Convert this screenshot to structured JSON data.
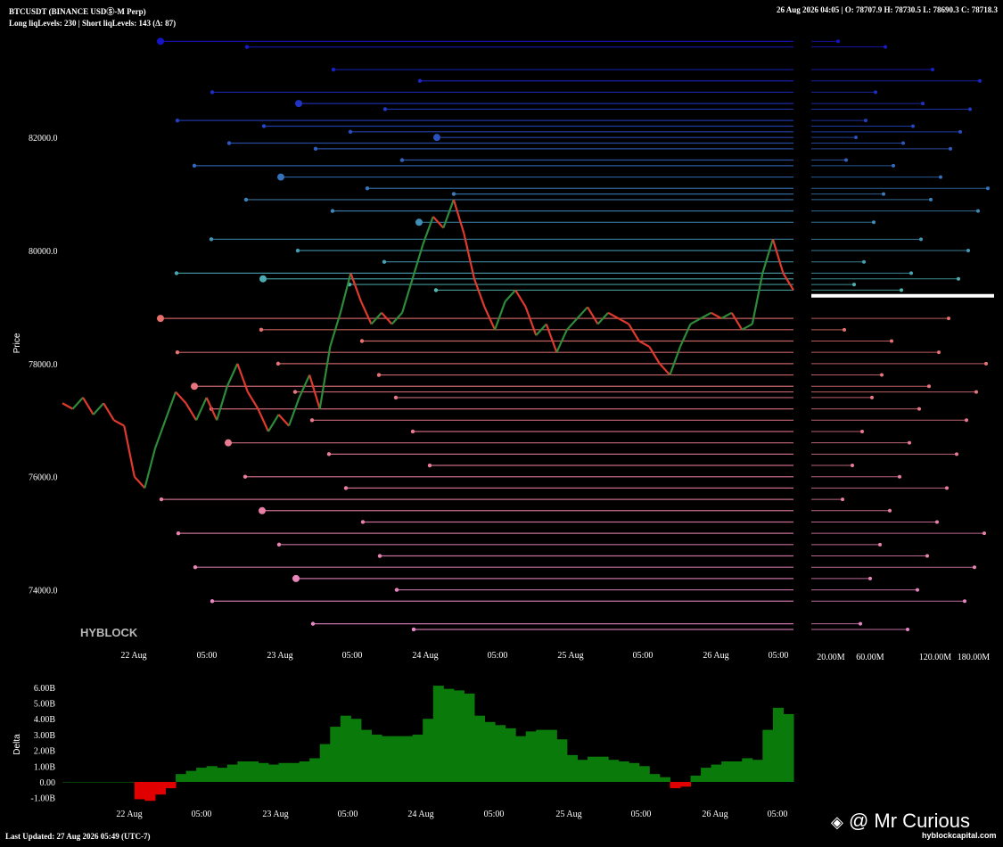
{
  "header": {
    "symbol": "BTCUSDT (BINANCE USDⓈ-M Perp)",
    "levels": "Long liqLevels: 230 | Short liqLevels: 143 (Δ: 87)",
    "ohlc": "26 Aug 2026 04:05 | O: 78707.9 H: 78730.5 L: 78690.3 C: 78718.3"
  },
  "footer": {
    "last_updated": "Last Updated: 27 Aug 2026 05:49 (UTC-7)",
    "credit": "@ Mr Curious",
    "site": "hyblockcapital.com"
  },
  "colors": {
    "candle_up": "#2e8b3a",
    "candle_down": "#e03a2e",
    "short_liq_far": "#1515c8",
    "short_liq_near": "#4fb8b0",
    "long_liq_near": "#e8706a",
    "long_liq_far": "#e888c8",
    "current_price_line": "#ffffff",
    "delta_positive": "#0a7a0a",
    "delta_negative": "#e00000"
  },
  "chart_data": [
    {
      "type": "line",
      "name": "price",
      "ylabel": "Price",
      "brand": "HYBLOCK",
      "yticks": [
        "82000.0",
        "80000.0",
        "78000.0",
        "76000.0",
        "74000.0"
      ],
      "ylim": [
        73000,
        83800
      ],
      "xticks": [
        "22 Aug",
        "05:00",
        "23 Aug",
        "05:00",
        "24 Aug",
        "05:00",
        "25 Aug",
        "05:00",
        "26 Aug",
        "05:00"
      ],
      "current_price": 79200,
      "price_path": [
        [
          0,
          77300
        ],
        [
          1,
          77200
        ],
        [
          2,
          77400
        ],
        [
          3,
          77100
        ],
        [
          4,
          77300
        ],
        [
          5,
          77000
        ],
        [
          6,
          76900
        ],
        [
          7,
          76000
        ],
        [
          8,
          75800
        ],
        [
          9,
          76500
        ],
        [
          10,
          77000
        ],
        [
          11,
          77500
        ],
        [
          12,
          77300
        ],
        [
          13,
          77000
        ],
        [
          14,
          77400
        ],
        [
          15,
          77000
        ],
        [
          16,
          77600
        ],
        [
          17,
          78000
        ],
        [
          18,
          77500
        ],
        [
          19,
          77200
        ],
        [
          20,
          76800
        ],
        [
          21,
          77100
        ],
        [
          22,
          76900
        ],
        [
          23,
          77400
        ],
        [
          24,
          77800
        ],
        [
          25,
          77200
        ],
        [
          26,
          78300
        ],
        [
          27,
          78900
        ],
        [
          28,
          79600
        ],
        [
          29,
          79100
        ],
        [
          30,
          78700
        ],
        [
          31,
          78900
        ],
        [
          32,
          78700
        ],
        [
          33,
          78900
        ],
        [
          34,
          79500
        ],
        [
          35,
          80100
        ],
        [
          36,
          80600
        ],
        [
          37,
          80400
        ],
        [
          38,
          80900
        ],
        [
          39,
          80300
        ],
        [
          40,
          79500
        ],
        [
          41,
          79000
        ],
        [
          42,
          78600
        ],
        [
          43,
          79100
        ],
        [
          44,
          79300
        ],
        [
          45,
          79000
        ],
        [
          46,
          78500
        ],
        [
          47,
          78700
        ],
        [
          48,
          78200
        ],
        [
          49,
          78600
        ],
        [
          50,
          78800
        ],
        [
          51,
          79000
        ],
        [
          52,
          78700
        ],
        [
          53,
          78900
        ],
        [
          54,
          78800
        ],
        [
          55,
          78700
        ],
        [
          56,
          78400
        ],
        [
          57,
          78300
        ],
        [
          58,
          78000
        ],
        [
          59,
          77800
        ],
        [
          60,
          78300
        ],
        [
          61,
          78700
        ],
        [
          62,
          78800
        ],
        [
          63,
          78900
        ],
        [
          64,
          78800
        ],
        [
          65,
          78900
        ],
        [
          66,
          78600
        ],
        [
          67,
          78700
        ],
        [
          68,
          79600
        ],
        [
          69,
          80200
        ],
        [
          70,
          79600
        ],
        [
          71,
          79300
        ]
      ],
      "short_liq_levels": [
        83700,
        83600,
        83200,
        83000,
        82800,
        82600,
        82500,
        82300,
        82200,
        82100,
        82000,
        81900,
        81800,
        81600,
        81500,
        81300,
        81100,
        81000,
        80900,
        80700,
        80500,
        80200,
        80000,
        79800,
        79600,
        79500,
        79400,
        79300
      ],
      "long_liq_levels": [
        78800,
        78600,
        78400,
        78200,
        78000,
        77800,
        77600,
        77500,
        77400,
        77200,
        77000,
        76800,
        76600,
        76400,
        76200,
        76000,
        75800,
        75600,
        75400,
        75200,
        75000,
        74800,
        74600,
        74400,
        74200,
        74000,
        73800,
        73400,
        73300
      ]
    },
    {
      "type": "bar",
      "name": "liq-profile",
      "xticks": [
        "20.00M",
        "60.00M",
        "120.00M",
        "180.00M"
      ]
    },
    {
      "type": "area",
      "name": "delta",
      "ylabel": "Delta",
      "yticks": [
        "6.00B",
        "5.00B",
        "4.00B",
        "3.00B",
        "2.00B",
        "1.00B",
        "0.00",
        "-1.00B"
      ],
      "ylim": [
        -1.3,
        6.5
      ],
      "xticks": [
        "22 Aug",
        "05:00",
        "23 Aug",
        "05:00",
        "24 Aug",
        "05:00",
        "25 Aug",
        "05:00",
        "26 Aug",
        "05:00"
      ],
      "values": [
        [
          0,
          0
        ],
        [
          1,
          0
        ],
        [
          2,
          0
        ],
        [
          3,
          0
        ],
        [
          4,
          0
        ],
        [
          5,
          0
        ],
        [
          6,
          0
        ],
        [
          7,
          -1.1
        ],
        [
          8,
          -1.2
        ],
        [
          9,
          -0.8
        ],
        [
          10,
          -0.4
        ],
        [
          11,
          0.5
        ],
        [
          12,
          0.7
        ],
        [
          13,
          0.9
        ],
        [
          14,
          1.0
        ],
        [
          15,
          0.9
        ],
        [
          16,
          1.1
        ],
        [
          17,
          1.3
        ],
        [
          18,
          1.3
        ],
        [
          19,
          1.2
        ],
        [
          20,
          1.1
        ],
        [
          21,
          1.2
        ],
        [
          22,
          1.2
        ],
        [
          23,
          1.3
        ],
        [
          24,
          1.5
        ],
        [
          25,
          2.4
        ],
        [
          26,
          3.5
        ],
        [
          27,
          4.2
        ],
        [
          28,
          4.0
        ],
        [
          29,
          3.3
        ],
        [
          30,
          3.0
        ],
        [
          31,
          2.9
        ],
        [
          32,
          2.9
        ],
        [
          33,
          2.9
        ],
        [
          34,
          3.0
        ],
        [
          35,
          4.0
        ],
        [
          36,
          6.1
        ],
        [
          37,
          5.9
        ],
        [
          38,
          5.8
        ],
        [
          39,
          5.6
        ],
        [
          40,
          4.2
        ],
        [
          41,
          3.8
        ],
        [
          42,
          3.6
        ],
        [
          43,
          3.4
        ],
        [
          44,
          2.9
        ],
        [
          45,
          3.2
        ],
        [
          46,
          3.3
        ],
        [
          47,
          3.3
        ],
        [
          48,
          2.7
        ],
        [
          49,
          1.7
        ],
        [
          50,
          1.4
        ],
        [
          51,
          1.6
        ],
        [
          52,
          1.6
        ],
        [
          53,
          1.4
        ],
        [
          54,
          1.3
        ],
        [
          55,
          1.2
        ],
        [
          56,
          1.0
        ],
        [
          57,
          0.5
        ],
        [
          58,
          0.3
        ],
        [
          59,
          -0.4
        ],
        [
          60,
          -0.3
        ],
        [
          61,
          0.4
        ],
        [
          62,
          0.9
        ],
        [
          63,
          1.1
        ],
        [
          64,
          1.3
        ],
        [
          65,
          1.3
        ],
        [
          66,
          1.5
        ],
        [
          67,
          1.4
        ],
        [
          68,
          3.3
        ],
        [
          69,
          4.7
        ],
        [
          70,
          4.3
        ],
        [
          71,
          3.5
        ]
      ]
    }
  ]
}
